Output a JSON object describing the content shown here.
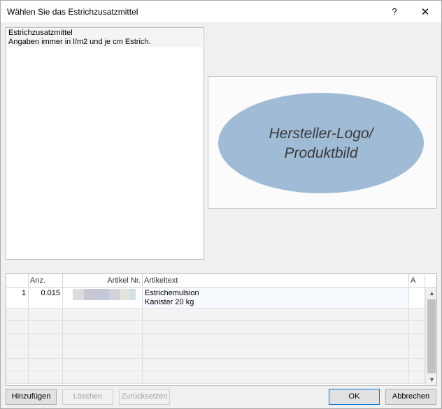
{
  "window": {
    "title": "Wählen Sie das Estrichzusatzmittel",
    "help_label": "?",
    "close_label": "✕"
  },
  "description": {
    "lines": [
      "Estrichzusatzmittel",
      "Angaben immer in l/m2 und je cm Estrich."
    ]
  },
  "image_placeholder": {
    "line1": "Hersteller-Logo/",
    "line2": "Produktbild",
    "fill_color": "#9fbbd5",
    "text_color": "#3a3a3a"
  },
  "grid": {
    "columns": [
      "",
      "Anz.",
      "Artikel Nr.",
      "Artikeltext",
      "A"
    ],
    "rows": [
      {
        "index": "1",
        "anz": "0.015",
        "artikeltext_line1": "Estrichemulsion",
        "artikeltext_line2": "Kanister 20 kg"
      }
    ],
    "scroll_up_icon": "▲",
    "scroll_down_icon": "▼"
  },
  "buttons": {
    "add": "Hinzufügen",
    "delete": "Löschen",
    "reset": "Zurücksetzen",
    "ok": "OK",
    "cancel": "Abbrechen"
  }
}
